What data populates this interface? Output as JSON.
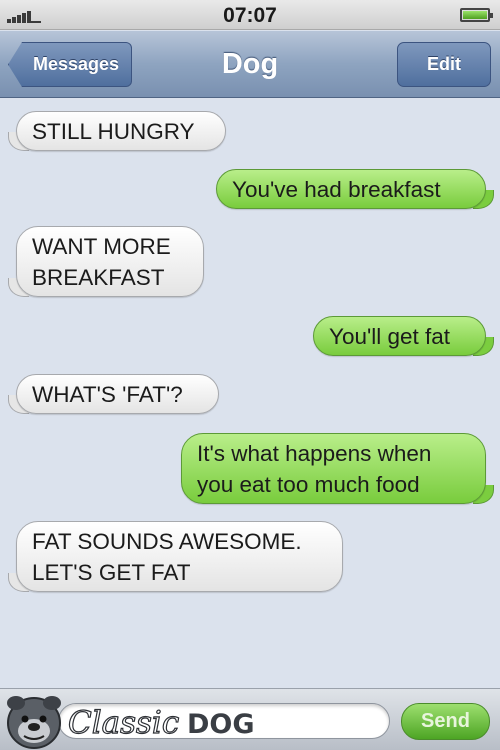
{
  "status_bar": {
    "time": "07:07"
  },
  "nav": {
    "back_label": "Messages",
    "title": "Dog",
    "edit_label": "Edit"
  },
  "messages": [
    {
      "from": "dog",
      "text": "STILL HUNGRY"
    },
    {
      "from": "me",
      "text": "You've had breakfast"
    },
    {
      "from": "dog",
      "text": "WANT MORE\nBREAKFAST"
    },
    {
      "from": "me",
      "text": "You'll get fat"
    },
    {
      "from": "dog",
      "text": "WHAT'S 'FAT'?"
    },
    {
      "from": "me",
      "text": "It's what happens when\nyou eat too much food"
    },
    {
      "from": "dog",
      "text": "FAT SOUNDS AWESOME.\nLET'S GET FAT"
    }
  ],
  "composer": {
    "send_label": "Send",
    "input_value": ""
  },
  "watermark": {
    "brand": "ClassicDOG"
  },
  "colors": {
    "incoming_bubble": "#ececec",
    "outgoing_bubble": "#8fd859",
    "nav_bar": "#8ea4c0",
    "send_button": "#6fc23d"
  },
  "icons": [
    "signal-bars-icon",
    "battery-icon",
    "bulldog-logo-icon"
  ]
}
